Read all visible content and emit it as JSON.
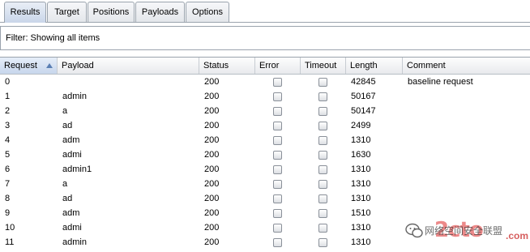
{
  "tabs": [
    {
      "label": "Results",
      "active": true
    },
    {
      "label": "Target",
      "active": false
    },
    {
      "label": "Positions",
      "active": false
    },
    {
      "label": "Payloads",
      "active": false
    },
    {
      "label": "Options",
      "active": false
    }
  ],
  "filter": {
    "text": "Filter:  Showing all items"
  },
  "table": {
    "columns": [
      "Request",
      "Payload",
      "Status",
      "Error",
      "Timeout",
      "Length",
      "Comment"
    ],
    "sorted_column": "Request",
    "sort_direction": "ascending",
    "rows": [
      {
        "request": "0",
        "payload": "",
        "status": "200",
        "error": false,
        "timeout": false,
        "length": "42845",
        "comment": "baseline request"
      },
      {
        "request": "1",
        "payload": "admin",
        "status": "200",
        "error": false,
        "timeout": false,
        "length": "50167",
        "comment": ""
      },
      {
        "request": "2",
        "payload": "a",
        "status": "200",
        "error": false,
        "timeout": false,
        "length": "50147",
        "comment": ""
      },
      {
        "request": "3",
        "payload": "ad",
        "status": "200",
        "error": false,
        "timeout": false,
        "length": "2499",
        "comment": ""
      },
      {
        "request": "4",
        "payload": "adm",
        "status": "200",
        "error": false,
        "timeout": false,
        "length": "1310",
        "comment": ""
      },
      {
        "request": "5",
        "payload": "admi",
        "status": "200",
        "error": false,
        "timeout": false,
        "length": "1630",
        "comment": ""
      },
      {
        "request": "6",
        "payload": "admin1",
        "status": "200",
        "error": false,
        "timeout": false,
        "length": "1310",
        "comment": ""
      },
      {
        "request": "7",
        "payload": "a",
        "status": "200",
        "error": false,
        "timeout": false,
        "length": "1310",
        "comment": ""
      },
      {
        "request": "8",
        "payload": "ad",
        "status": "200",
        "error": false,
        "timeout": false,
        "length": "1310",
        "comment": ""
      },
      {
        "request": "9",
        "payload": "adm",
        "status": "200",
        "error": false,
        "timeout": false,
        "length": "1510",
        "comment": ""
      },
      {
        "request": "10",
        "payload": "admi",
        "status": "200",
        "error": false,
        "timeout": false,
        "length": "1310",
        "comment": ""
      },
      {
        "request": "11",
        "payload": "admin",
        "status": "200",
        "error": false,
        "timeout": false,
        "length": "1310",
        "comment": ""
      }
    ]
  },
  "watermark": {
    "logo": "2cto",
    "text": "网络空间安全联盟",
    "suffix": ".com",
    "icon": "wechat-icon"
  }
}
